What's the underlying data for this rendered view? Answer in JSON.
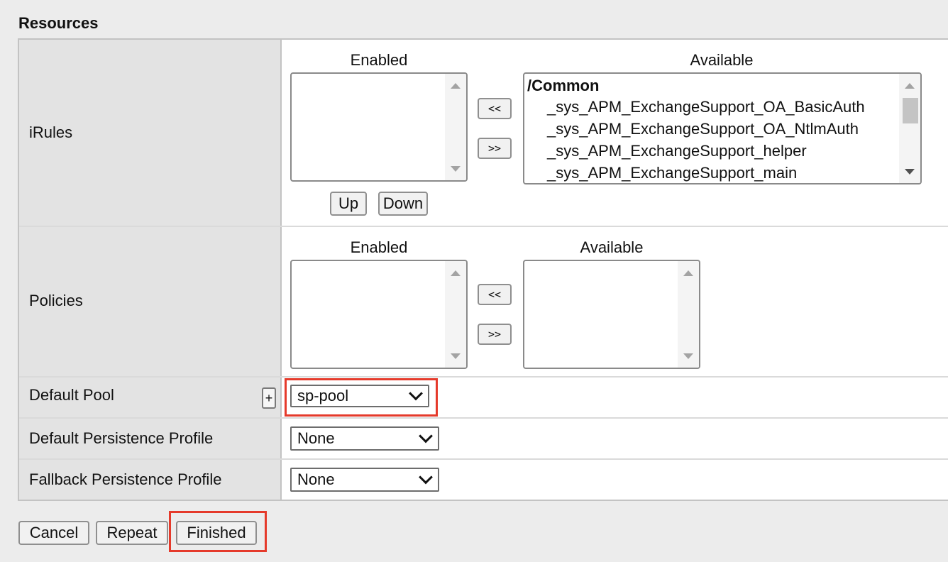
{
  "section": {
    "title": "Resources"
  },
  "irules": {
    "label": "iRules",
    "enabled_caption": "Enabled",
    "available_caption": "Available",
    "enabled_items": [],
    "available_group": "/Common",
    "available_items": [
      "_sys_APM_ExchangeSupport_OA_BasicAuth",
      "_sys_APM_ExchangeSupport_OA_NtlmAuth",
      "_sys_APM_ExchangeSupport_helper",
      "_sys_APM_ExchangeSupport_main"
    ],
    "move_left_label": "<<",
    "move_right_label": ">>",
    "up_label": "Up",
    "down_label": "Down"
  },
  "policies": {
    "label": "Policies",
    "enabled_caption": "Enabled",
    "available_caption": "Available",
    "enabled_items": [],
    "available_items": [],
    "move_left_label": "<<",
    "move_right_label": ">>"
  },
  "default_pool": {
    "label": "Default Pool",
    "add_label": "+",
    "selected": "sp-pool"
  },
  "default_persistence": {
    "label": "Default Persistence Profile",
    "selected": "None"
  },
  "fallback_persistence": {
    "label": "Fallback Persistence Profile",
    "selected": "None"
  },
  "actions": {
    "cancel": "Cancel",
    "repeat": "Repeat",
    "finished": "Finished"
  },
  "colors": {
    "highlight": "#e53a2b",
    "label_background": "#e3e3e3",
    "page_background": "#ececec"
  }
}
